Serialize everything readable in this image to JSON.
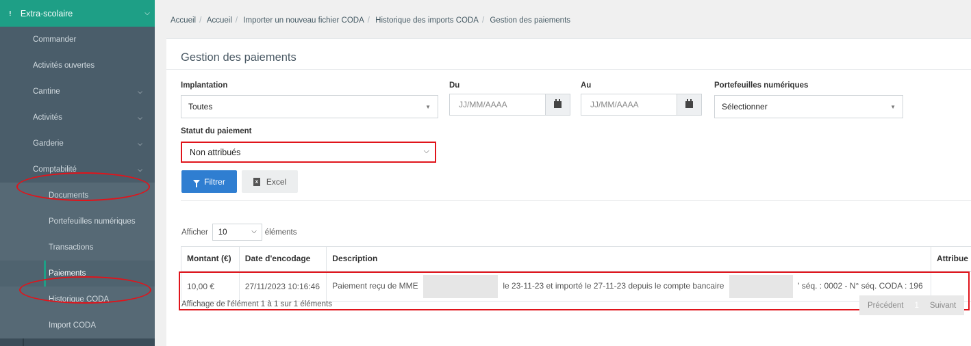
{
  "sidebar": {
    "section_title": "Extra-scolaire",
    "items": [
      {
        "label": "Commander",
        "has_chevron": false
      },
      {
        "label": "Activités ouvertes",
        "has_chevron": false
      },
      {
        "label": "Cantine",
        "has_chevron": true
      },
      {
        "label": "Activités",
        "has_chevron": true
      },
      {
        "label": "Garderie",
        "has_chevron": true
      },
      {
        "label": "Comptabilité",
        "has_chevron": true
      }
    ],
    "sub_items": [
      {
        "label": "Documents"
      },
      {
        "label": "Portefeuilles numériques"
      },
      {
        "label": "Transactions"
      },
      {
        "label": "Paiements",
        "active": true
      },
      {
        "label": "Historique CODA"
      },
      {
        "label": "Import CODA"
      }
    ]
  },
  "breadcrumb": [
    "Accueil",
    "Accueil",
    "Importer un nouveau fichier CODA",
    "Historique des imports CODA",
    "Gestion des paiements"
  ],
  "page_title": "Gestion des paiements",
  "filters": {
    "implantation_label": "Implantation",
    "implantation_value": "Toutes",
    "du_label": "Du",
    "du_placeholder": "JJ/MM/AAAA",
    "au_label": "Au",
    "au_placeholder": "JJ/MM/AAAA",
    "portefeuilles_label": "Portefeuilles numériques",
    "portefeuilles_value": "Sélectionner",
    "statut_label": "Statut du paiement",
    "statut_value": "Non attribués"
  },
  "buttons": {
    "filter": "Filtrer",
    "excel": "Excel"
  },
  "table": {
    "show_prefix": "Afficher",
    "page_length": "10",
    "show_suffix": "éléments",
    "columns": [
      "Montant (€)",
      "Date d'encodage",
      "Description",
      "Attribué"
    ],
    "columns_visible": [
      "Montant (€)",
      "Date d'encodage",
      "Description",
      "Attribue"
    ],
    "rows": [
      {
        "montant": "10,00 €",
        "date": "27/11/2023 10:16:46",
        "desc_part1": "Paiement reçu de MME",
        "desc_part2": "le 23-11-23 et importé le 27-11-23 depuis le compte bancaire",
        "desc_part3": "' séq. : 0002 - N° séq. CODA : 196",
        "attribue": ""
      }
    ],
    "info": "Affichage de l'élément 1 à 1 sur 1 éléments",
    "prev": "Précédent",
    "current_page": "1",
    "next": "Suivant"
  },
  "colors": {
    "accent_green": "#1e9f86",
    "primary_blue": "#2f7ed1",
    "annotation_red": "#e0141b"
  }
}
